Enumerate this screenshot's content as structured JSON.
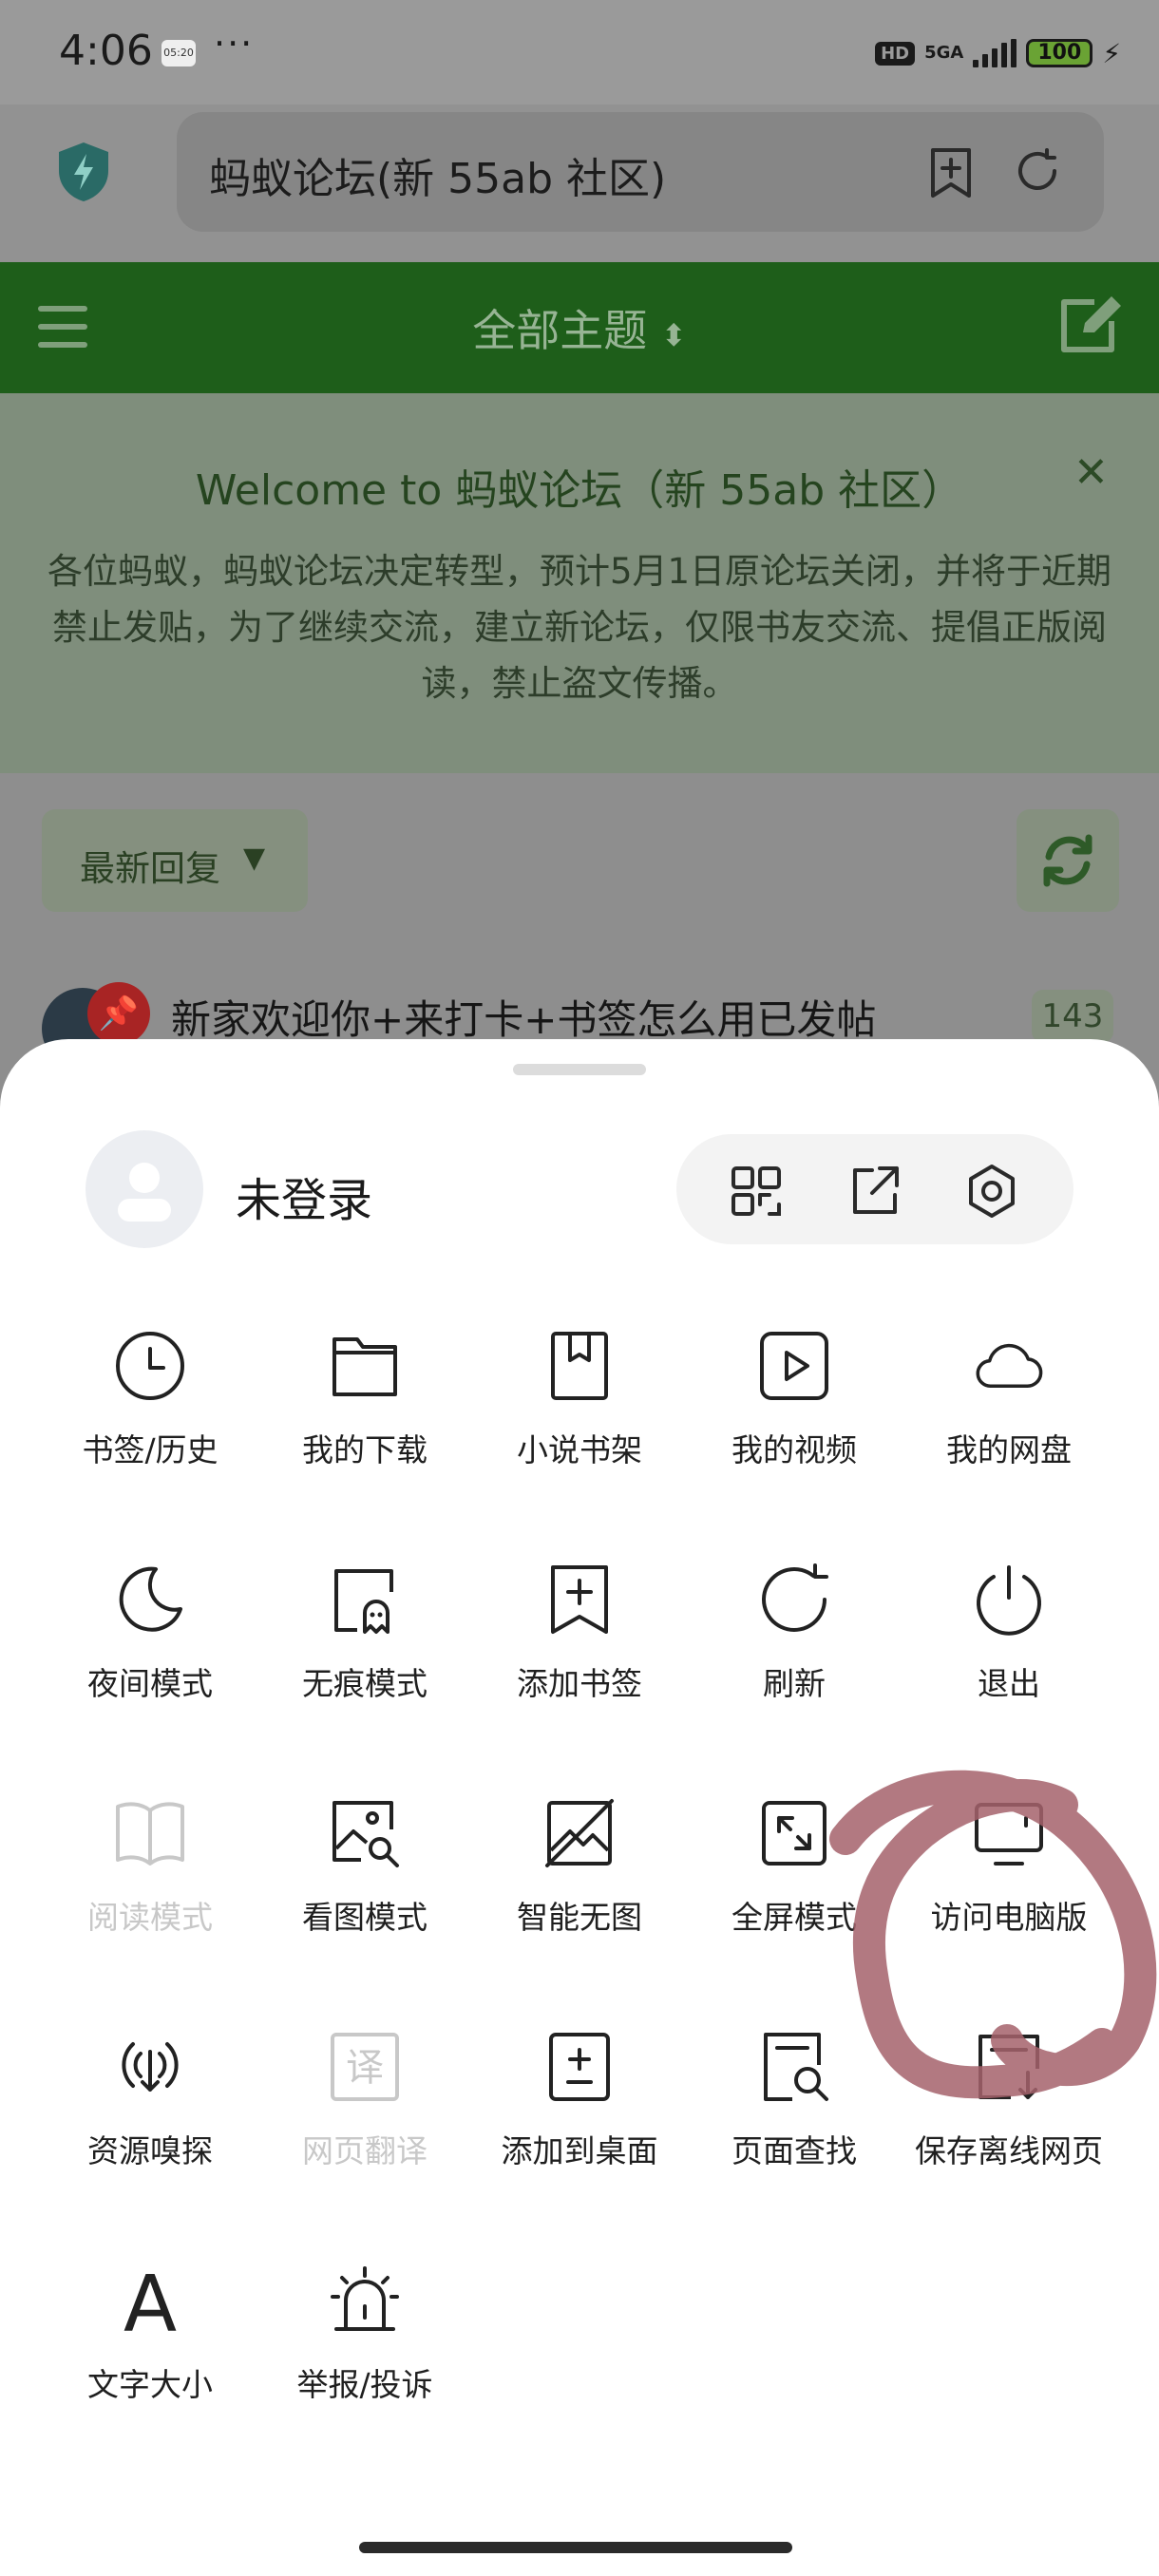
{
  "status_bar": {
    "time": "4:06",
    "notif_chip": "05:20",
    "dots": "···",
    "hd": "HD",
    "network": "5GA",
    "battery": "100"
  },
  "address_bar": {
    "title": "蚂蚁论坛(新 55ab 社区)"
  },
  "green_bar": {
    "title": "全部主题",
    "caret": "⬍"
  },
  "welcome": {
    "title": "Welcome to 蚂蚁论坛（新 55ab 社区）",
    "close": "✕",
    "body": "各位蚂蚁，蚂蚁论坛决定转型，预计5月1日原论坛关闭，并将于近期禁止发贴，为了继续交流，建立新论坛，仅限书友交流、提倡正版阅读，禁止盗文传播。"
  },
  "filter": {
    "label": "最新回复",
    "caret": "▼"
  },
  "thread": {
    "pin": "📌",
    "title": "新家欢迎你+来打卡+书签怎么用已发帖",
    "count": "143"
  },
  "menu": {
    "user_name": "未登录",
    "items": [
      {
        "label": "书签/历史",
        "icon": "clock-icon",
        "disabled": false
      },
      {
        "label": "我的下载",
        "icon": "folder-icon",
        "disabled": false
      },
      {
        "label": "小说书架",
        "icon": "book-bookmark-icon",
        "disabled": false
      },
      {
        "label": "我的视频",
        "icon": "play-icon",
        "disabled": false
      },
      {
        "label": "我的网盘",
        "icon": "cloud-icon",
        "disabled": false
      },
      {
        "label": "夜间模式",
        "icon": "moon-icon",
        "disabled": false
      },
      {
        "label": "无痕模式",
        "icon": "ghost-icon",
        "disabled": false
      },
      {
        "label": "添加书签",
        "icon": "bookmark-add-icon",
        "disabled": false
      },
      {
        "label": "刷新",
        "icon": "refresh-icon",
        "disabled": false
      },
      {
        "label": "退出",
        "icon": "power-icon",
        "disabled": false
      },
      {
        "label": "阅读模式",
        "icon": "open-book-icon",
        "disabled": true
      },
      {
        "label": "看图模式",
        "icon": "image-search-icon",
        "disabled": false
      },
      {
        "label": "智能无图",
        "icon": "no-image-icon",
        "disabled": false
      },
      {
        "label": "全屏模式",
        "icon": "fullscreen-icon",
        "disabled": false
      },
      {
        "label": "访问电脑版",
        "icon": "monitor-icon",
        "disabled": false
      },
      {
        "label": "资源嗅探",
        "icon": "sniff-icon",
        "disabled": false
      },
      {
        "label": "网页翻译",
        "icon": "translate-icon",
        "disabled": true
      },
      {
        "label": "添加到桌面",
        "icon": "add-to-desktop-icon",
        "disabled": false
      },
      {
        "label": "页面查找",
        "icon": "page-search-icon",
        "disabled": false
      },
      {
        "label": "保存离线网页",
        "icon": "save-offline-icon",
        "disabled": false
      },
      {
        "label": "文字大小",
        "icon": "text-size-icon",
        "disabled": false
      },
      {
        "label": "举报/投诉",
        "icon": "alarm-icon",
        "disabled": false
      }
    ]
  },
  "translate_glyph": "译",
  "text_size_glyph": "A",
  "colors": {
    "green_bar": "#1e5e1a",
    "annotation": "#a5616b",
    "disabled": "#c8c8c8"
  }
}
